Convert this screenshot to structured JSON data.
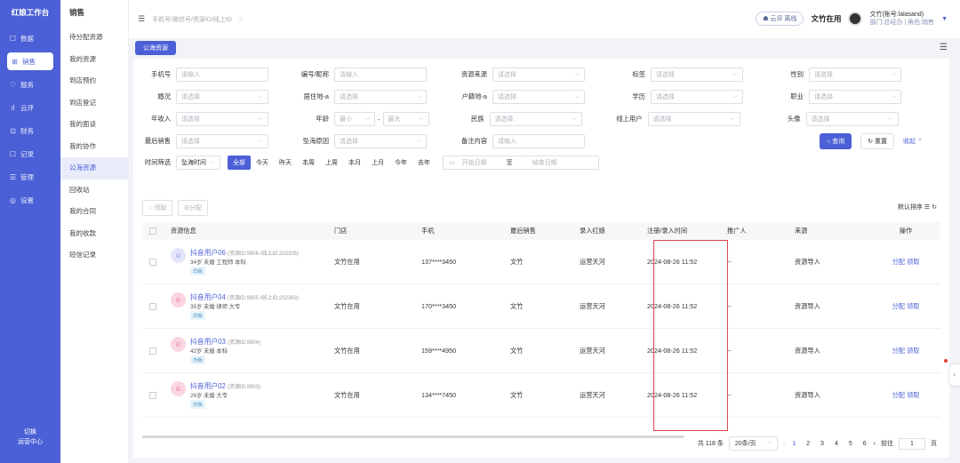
{
  "brand": "红娘工作台",
  "nav": [
    {
      "icon": "☐",
      "label": "数据"
    },
    {
      "icon": "⊞",
      "label": "销售"
    },
    {
      "icon": "♡",
      "label": "服务"
    },
    {
      "icon": "ıl",
      "label": "云评"
    },
    {
      "icon": "⊡",
      "label": "财务"
    },
    {
      "icon": "☐",
      "label": "记录"
    },
    {
      "icon": "☰",
      "label": "管理"
    },
    {
      "icon": "◎",
      "label": "设置"
    }
  ],
  "nav_footer": [
    "切换",
    "运营中心"
  ],
  "subnav": {
    "title": "销售",
    "items": [
      "待分配资源",
      "我的资源",
      "到店预约",
      "到店登记",
      "我的面谈",
      "我的协作",
      "公海资源",
      "回收站",
      "我的合同",
      "我的收款",
      "短信记录"
    ]
  },
  "topbar": {
    "search_placeholder": "手机号/微信号/资源ID/线上ID",
    "cloud": "云评 离线",
    "store": "文竹在用",
    "user": "文竹(账号:lalasand)",
    "user_sub": "部门:总经办 | 角色:销售"
  },
  "tab": "公海资源",
  "filters": {
    "r1": [
      "手机号",
      "请输入",
      "编号/昵称",
      "请输入",
      "资源来源",
      "请选择",
      "标签",
      "请选择",
      "性别",
      "请选择"
    ],
    "r2": [
      "婚况",
      "请选择",
      "居住地-a",
      "请选择",
      "户籍地-a",
      "请选择",
      "学历",
      "请选择",
      "职业",
      "请选择"
    ],
    "r3": [
      "年收入",
      "请选择",
      "年龄",
      "最小",
      "最大",
      "民族",
      "请选择",
      "线上用户",
      "请选择",
      "头像",
      "请选择"
    ],
    "r4": [
      "最后销售",
      "请选择",
      "坠海原因",
      "请选择",
      "备注内容",
      "请输入"
    ],
    "query": "查询",
    "reset": "重置",
    "collapse": "收起",
    "time_label": "时间筛选",
    "time_type": "坠海时间",
    "time_tags": [
      "全部",
      "今天",
      "昨天",
      "本周",
      "上周",
      "本月",
      "上月",
      "今年",
      "去年"
    ],
    "date_start": "开始日期",
    "date_to": "至",
    "date_end": "结束日期"
  },
  "table": {
    "btn_claim": "领取",
    "btn_assign": "分配",
    "sort_label": "默认排序",
    "headers": [
      "资源信息",
      "门店",
      "手机",
      "最后销售",
      "录入红娘",
      "注册/录入时间",
      "推广人",
      "来源",
      "操作"
    ],
    "rows": [
      {
        "name": "抖音用户06",
        "ids": "(资源ID:9906 /线上ID:202305)",
        "meta": "34岁 未婚 工程师 本科",
        "tag": "白板",
        "store": "文竹在用",
        "phone": "137****3450",
        "sales": "文竹",
        "entry": "运营天河",
        "time": "2024-08-26 11:52",
        "promoter": "--",
        "source": "资源导入",
        "op1": "分配",
        "op2": "领取"
      },
      {
        "name": "抖音用户04",
        "ids": "(资源ID:9905 /线上ID:202363)",
        "meta": "35岁 未婚 律师 大专",
        "tag": "白板",
        "store": "文竹在用",
        "phone": "170****3450",
        "sales": "文竹",
        "entry": "运营天河",
        "time": "2024-08-26 11:52",
        "promoter": "--",
        "source": "资源导入",
        "op1": "分配",
        "op2": "领取"
      },
      {
        "name": "抖音用户03",
        "ids": "(资源ID:9904)",
        "meta": "42岁 未婚 本科",
        "tag": "白板",
        "store": "文竹在用",
        "phone": "159****4950",
        "sales": "文竹",
        "entry": "运营天河",
        "time": "2024-08-26 11:52",
        "promoter": "--",
        "source": "资源导入",
        "op1": "分配",
        "op2": "领取"
      },
      {
        "name": "抖音用户02",
        "ids": "(资源ID:9903)",
        "meta": "26岁 未婚 大专",
        "tag": "白板",
        "store": "文竹在用",
        "phone": "134****7450",
        "sales": "文竹",
        "entry": "运营天河",
        "time": "2024-08-26 11:52",
        "promoter": "--",
        "source": "资源导入",
        "op1": "分配",
        "op2": "领取"
      }
    ]
  },
  "pager": {
    "total": "共 118 条",
    "size": "20条/页",
    "pages": [
      "1",
      "2",
      "3",
      "4",
      "5",
      "6"
    ],
    "goto": "前往",
    "goto_val": "1",
    "unit": "页"
  }
}
